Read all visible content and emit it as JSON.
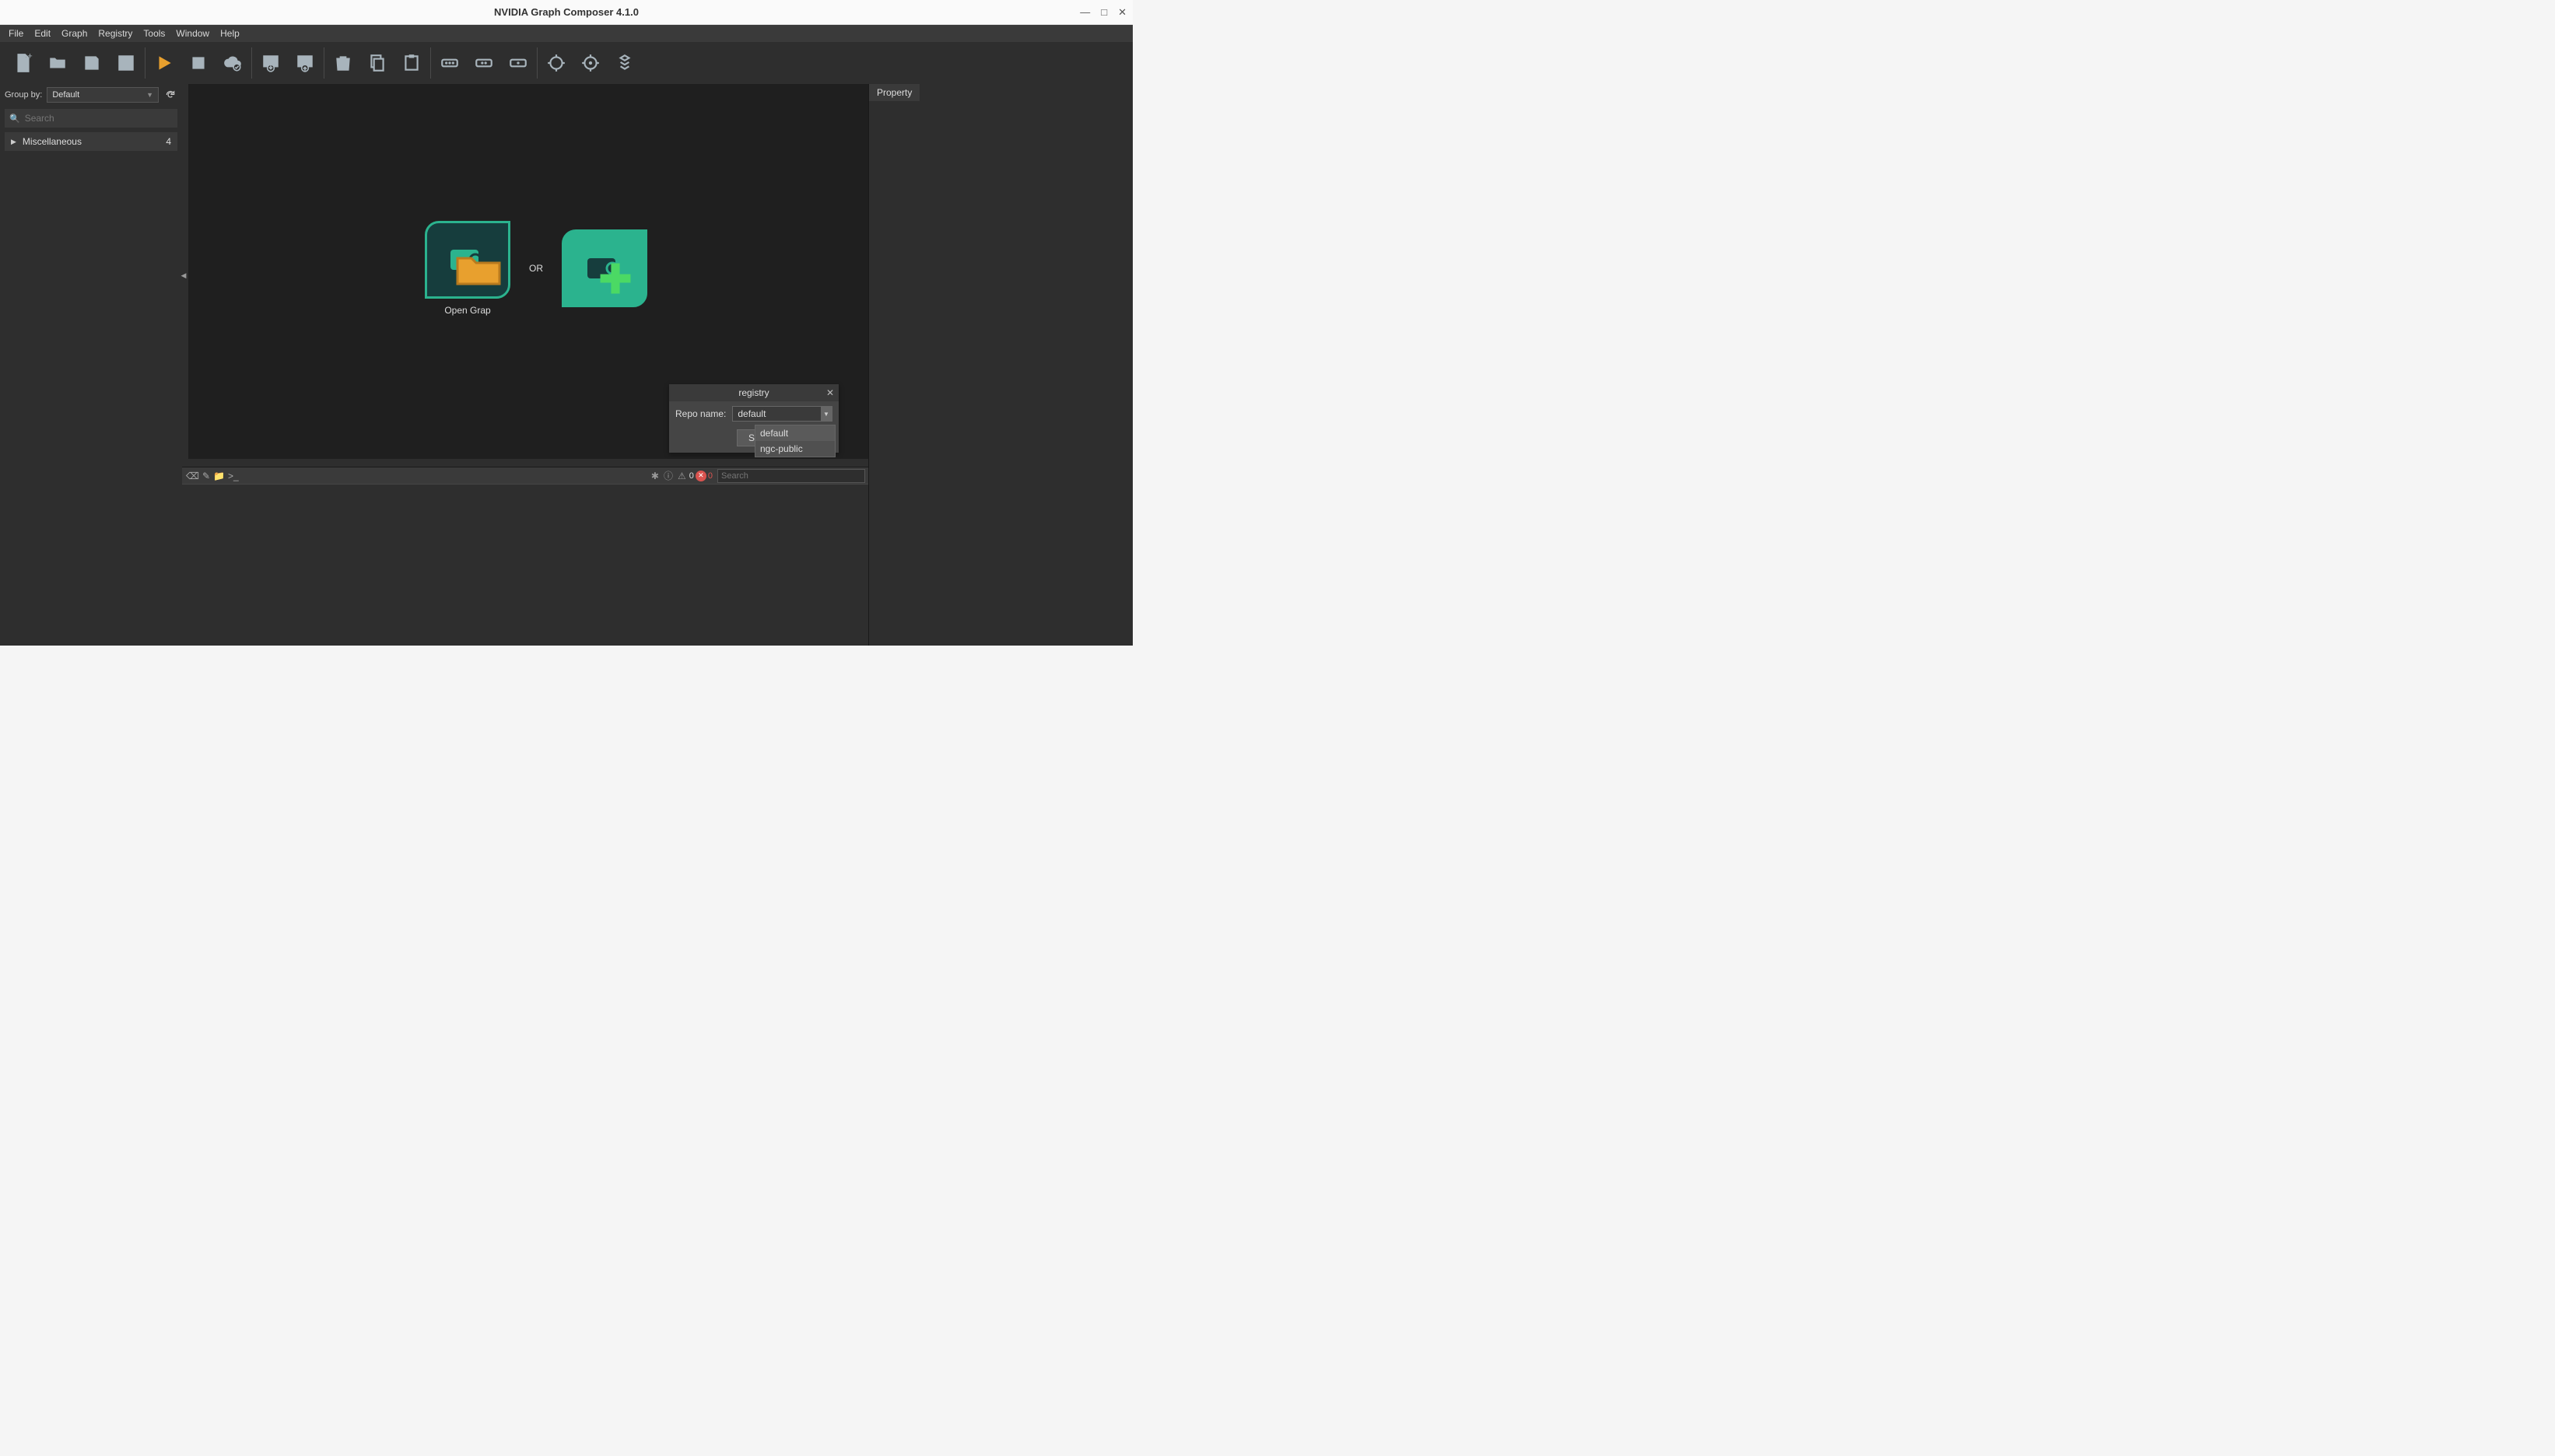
{
  "window": {
    "title": "NVIDIA Graph Composer 4.1.0"
  },
  "menu": [
    "File",
    "Edit",
    "Graph",
    "Registry",
    "Tools",
    "Window",
    "Help"
  ],
  "toolbar_icons": [
    "new-file",
    "open-folder",
    "save-disk",
    "close-file",
    "sep",
    "play",
    "stop",
    "cloud-check",
    "sep",
    "download-box",
    "upload-box",
    "sep",
    "trash",
    "copy",
    "paste",
    "sep",
    "more-3dots",
    "more-2dots",
    "more-1dot",
    "sep",
    "target",
    "target-2",
    "cube-stack"
  ],
  "left": {
    "group_by_label": "Group by:",
    "group_by_value": "Default",
    "search_placeholder": "Search",
    "tree": [
      {
        "label": "Miscellaneous",
        "count": "4"
      }
    ]
  },
  "welcome": {
    "open_label": "Open Grap",
    "or": "OR"
  },
  "dialog": {
    "title": "registry",
    "repo_label": "Repo name:",
    "repo_value": "default",
    "sync_button": "Sy",
    "options": [
      "default",
      "ngc-public"
    ]
  },
  "console": {
    "warn_count": "0",
    "error_count": "0",
    "search_placeholder": "Search"
  },
  "right": {
    "tab": "Property"
  }
}
